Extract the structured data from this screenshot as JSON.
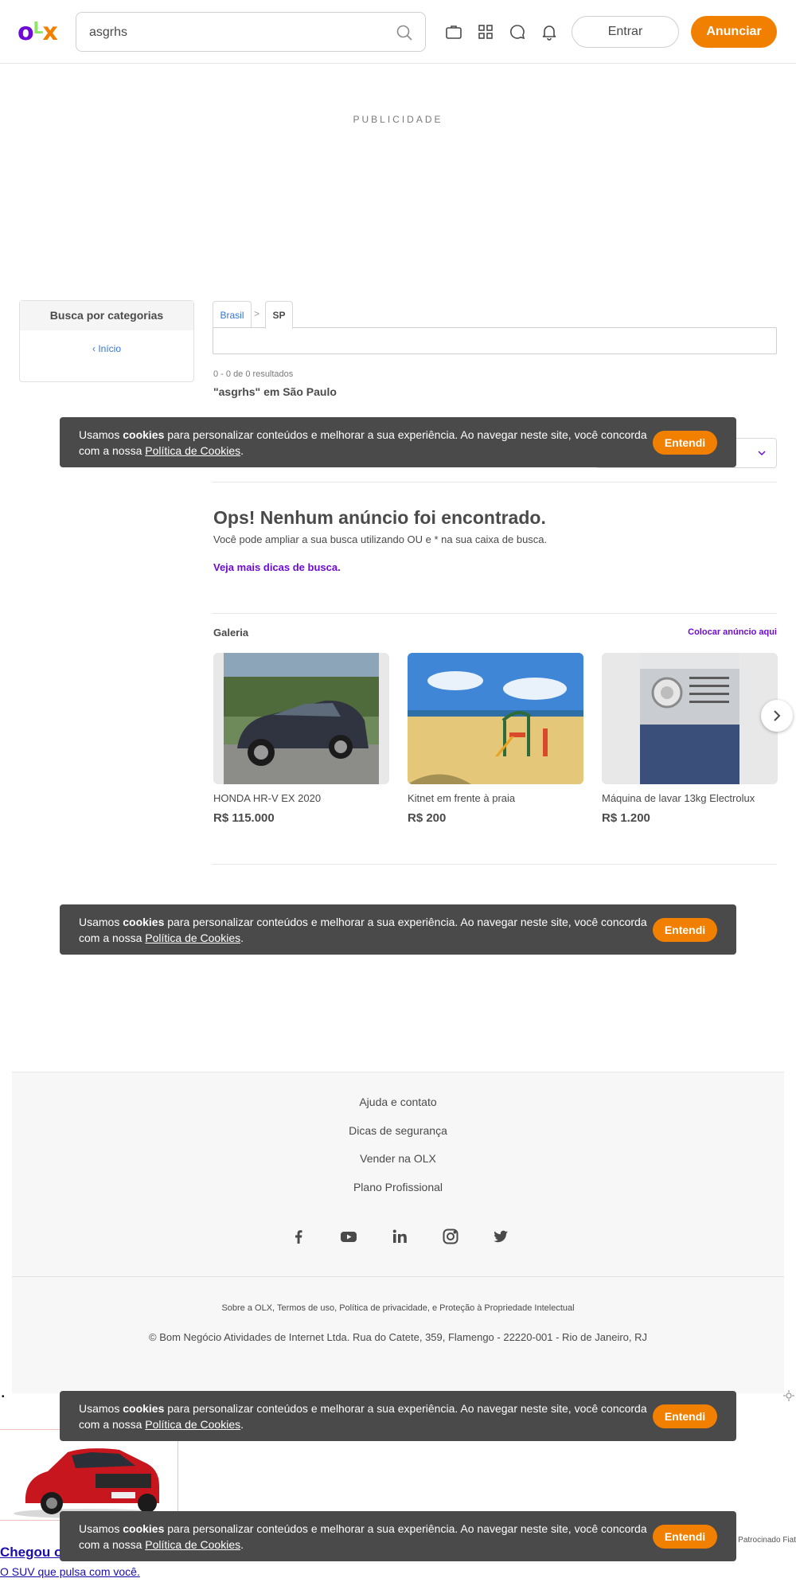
{
  "header": {
    "search_value": "asgrhs",
    "entrar_label": "Entrar",
    "anunciar_label": "Anunciar",
    "icons": [
      "briefcase-icon",
      "grid-icon",
      "chat-icon",
      "bell-icon"
    ]
  },
  "ad_label": "PUBLICIDADE",
  "sidebar": {
    "title": "Busca por categorias",
    "home_label": "Início"
  },
  "breadcrumb": {
    "brasil": "Brasil",
    "separator": ">",
    "sp": "SP"
  },
  "results": {
    "count": "0 - 0 de 0 resultados",
    "title": "\"asgrhs\" em São Paulo"
  },
  "empty": {
    "title": "Ops! Nenhum anúncio foi encontrado.",
    "text": "Você pode ampliar a sua busca utilizando OU e * na sua caixa de busca.",
    "link": "Veja mais dicas de busca."
  },
  "gallery": {
    "title": "Galeria",
    "link": "Colocar anúncio aqui",
    "items": [
      {
        "title": "HONDA HR-V EX 2020",
        "price": "R$ 115.000"
      },
      {
        "title": "Kitnet em frente à praia",
        "price": "R$ 200"
      },
      {
        "title": "Máquina de lavar 13kg Electrolux",
        "price": "R$ 1.200"
      }
    ]
  },
  "cookie": {
    "text_before": "Usamos ",
    "text_bold": "cookies",
    "text_middle": " para personalizar conteúdos e melhorar a sua experiência. Ao navegar neste site, você concorda com a nossa ",
    "policy_link": "Política de Cookies",
    "text_end": ".",
    "button": "Entendi"
  },
  "footer": {
    "links": [
      "Ajuda e contato",
      "Dicas de segurança",
      "Vender na OLX",
      "Plano Profissional"
    ],
    "social": [
      "facebook-icon",
      "youtube-icon",
      "linkedin-icon",
      "instagram-icon",
      "twitter-icon"
    ],
    "legal_links": "Sobre a OLX, Termos de uso, Política de privacidade, e Proteção à Propriedade Intelectual",
    "copyright": "© Bom Negócio Atividades de Internet Ltda. Rua do Catete, 359, Flamengo - 22220-001 - Rio de Janeiro, RJ"
  },
  "ad": {
    "bullet": "•",
    "headline": "Chegou o",
    "description": "O SUV que pulsa com você.",
    "sponsor": "Patrocinado Fiat"
  },
  "colors": {
    "brand_purple": "#6e0ad6",
    "brand_orange": "#f28000",
    "brand_green": "#8ce563"
  }
}
